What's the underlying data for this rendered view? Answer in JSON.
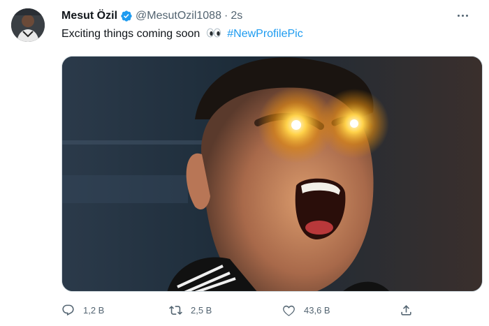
{
  "tweet": {
    "author_name": "Mesut Özil",
    "handle": "@MesutOzil1088",
    "separator": "·",
    "time": "2s",
    "text": "Exciting things coming soon",
    "emoji": "eyes-emoji",
    "hashtag": "#NewProfilePic",
    "image_description_icon": "photo"
  },
  "actions": {
    "reply_count": "1,2 B",
    "retweet_count": "2,5 B",
    "like_count": "43,6 B"
  },
  "colors": {
    "accent": "#1d9bf0",
    "secondary_text": "#536471",
    "primary_text": "#0f1419",
    "verified": "#1d9bf0"
  }
}
